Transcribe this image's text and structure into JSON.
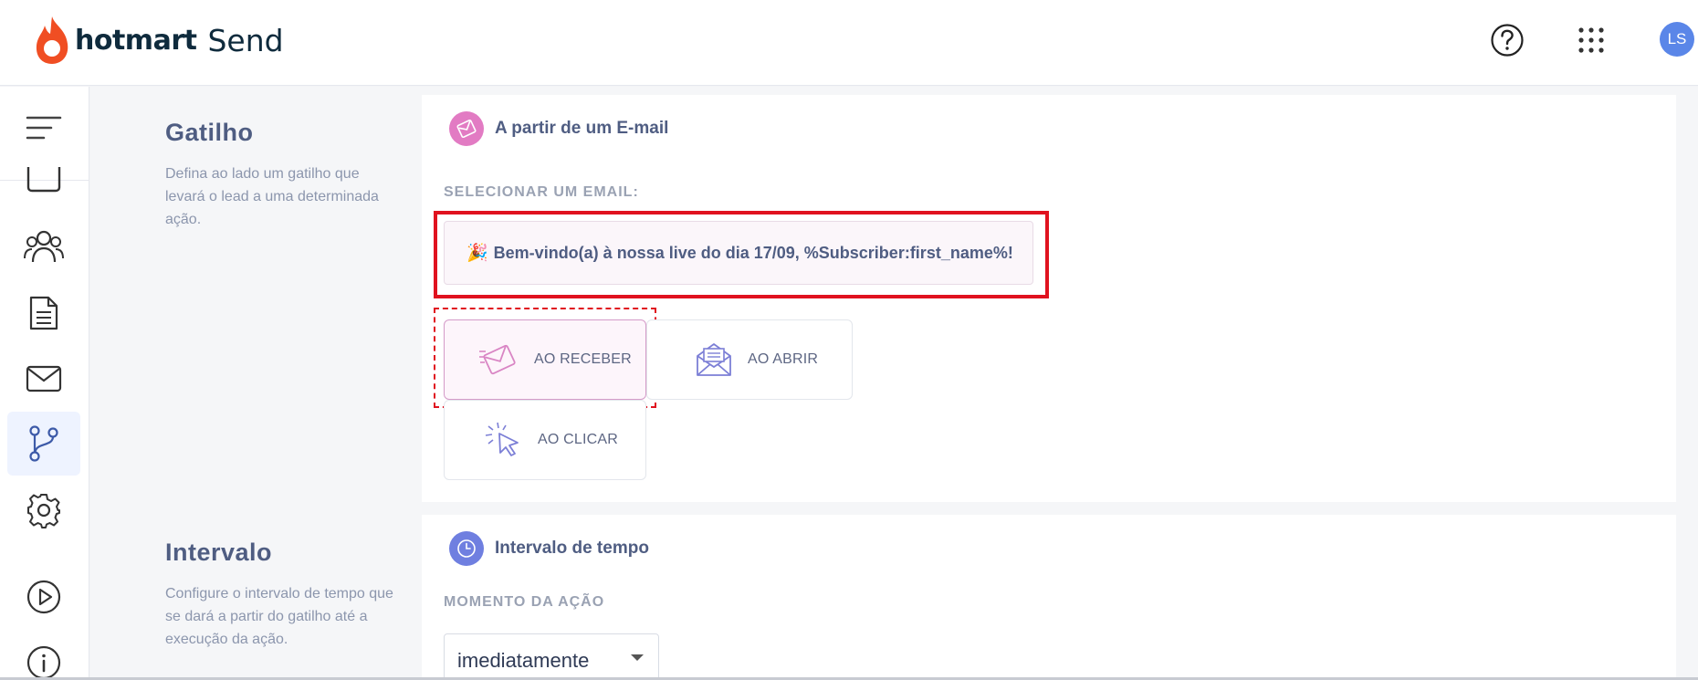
{
  "header": {
    "brand": "hotmart",
    "product": "Send",
    "avatar_initials": "LS",
    "icons": [
      "help-icon",
      "apps-grid-icon"
    ]
  },
  "sidebar": {
    "items": [
      {
        "icon": "menu-icon"
      },
      {
        "icon": "calendar-icon"
      },
      {
        "icon": "users-icon"
      },
      {
        "icon": "document-icon"
      },
      {
        "icon": "mail-icon"
      },
      {
        "icon": "automation-branch-icon",
        "active": true
      },
      {
        "icon": "gear-icon"
      },
      {
        "icon": "play-circle-icon"
      },
      {
        "icon": "info-icon"
      }
    ]
  },
  "trigger_section": {
    "title": "Gatilho",
    "description": "Defina ao lado um gatilho que levará o lead a uma determinada ação.",
    "card_title": "A partir de um E-mail",
    "select_label": "SELECIONAR UM EMAIL:",
    "selected_email": "Bem-vindo(a) à nossa live do dia 17/09, %Subscriber:first_name%!",
    "selected_email_emoji": "🎉",
    "options": [
      {
        "label": "AO RECEBER",
        "icon": "email-send-icon",
        "selected": true
      },
      {
        "label": "AO ABRIR",
        "icon": "email-open-icon",
        "selected": false
      },
      {
        "label": "AO CLICAR",
        "icon": "cursor-click-icon",
        "selected": false
      }
    ]
  },
  "interval_section": {
    "title": "Intervalo",
    "description": "Configure o intervalo de tempo que se dará a partir do gatilho até a execução da ação.",
    "card_title": "Intervalo de tempo",
    "moment_label": "MOMENTO DA AÇÃO",
    "moment_value": "imediatamente"
  },
  "colors": {
    "accent_pink": "#e27bc3",
    "accent_blue": "#6f7fe0",
    "highlight_red": "#e0121f",
    "brand_orange": "#f04e23"
  }
}
